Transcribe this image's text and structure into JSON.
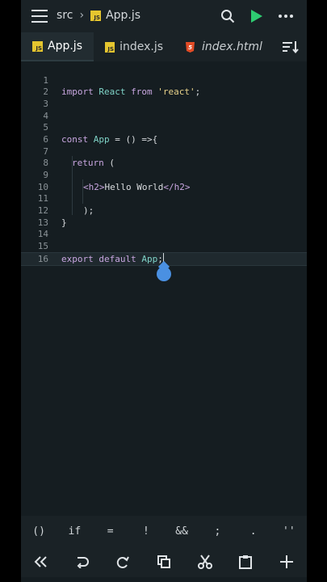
{
  "header": {
    "breadcrumb_folder": "src",
    "breadcrumb_file": "App.js",
    "file_badge": "JS"
  },
  "tabs": [
    {
      "label": "App.js",
      "badge": "JS"
    },
    {
      "label": "index.js",
      "badge": "JS"
    },
    {
      "label": "index.html",
      "badge": "5"
    }
  ],
  "editor": {
    "line_numbers": [
      "1",
      "2",
      "3",
      "4",
      "5",
      "6",
      "7",
      "8",
      "9",
      "10",
      "11",
      "12",
      "13",
      "14",
      "15",
      "16"
    ],
    "code": {
      "l2_import": "import",
      "l2_react": "React",
      "l2_from": "from",
      "l2_str": "'react'",
      "l2_semi": ";",
      "l6_const": "const",
      "l6_app": "App",
      "l6_rest": " = () =>{",
      "l8_return": "return",
      "l8_paren": " (",
      "l10_open": "<h2>",
      "l10_text": "Hello World",
      "l10_close": "</h2>",
      "l12": ");",
      "l13": "}",
      "l16_export": "export",
      "l16_default": "default",
      "l16_app": "App",
      "l16_semi": ";"
    },
    "active_line": 16
  },
  "symbols": [
    "()",
    "if",
    "=",
    "!",
    "&&",
    ";",
    ".",
    "''"
  ],
  "toolbar_icons": [
    "double-chevron-left-icon",
    "undo-icon",
    "redo-icon",
    "copy-icon",
    "cut-icon",
    "paste-icon",
    "plus-icon"
  ],
  "colors": {
    "bg": "#151d21",
    "keyword": "#c8a6e0",
    "identifier": "#7fd3c7",
    "string": "#e8d28a",
    "run": "#2ecc71",
    "cursor_handle": "#4a90e2"
  }
}
